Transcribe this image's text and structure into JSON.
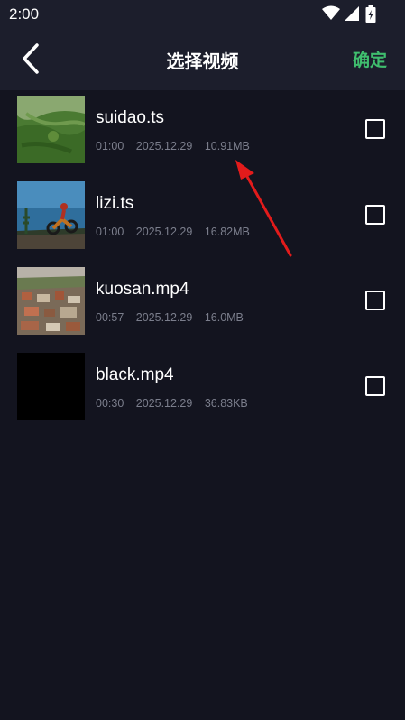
{
  "status_bar": {
    "time": "2:00",
    "icons": [
      "wifi-icon",
      "signal-icon",
      "battery-icon"
    ]
  },
  "app_bar": {
    "title": "选择视频",
    "confirm_label": "确定",
    "back_icon": "chevron-left-icon",
    "accent_color": "#3fbe6e"
  },
  "videos": [
    {
      "name": "suidao.ts",
      "duration": "01:00",
      "date": "2025.12.29",
      "size": "10.91MB",
      "checked": false,
      "thumbnail": "green-hills-aerial"
    },
    {
      "name": "lizi.ts",
      "duration": "01:00",
      "date": "2025.12.29",
      "size": "16.82MB",
      "checked": false,
      "thumbnail": "motocross-rider"
    },
    {
      "name": "kuosan.mp4",
      "duration": "00:57",
      "date": "2025.12.29",
      "size": "16.0MB",
      "checked": false,
      "thumbnail": "town-aerial"
    },
    {
      "name": "black.mp4",
      "duration": "00:30",
      "date": "2025.12.29",
      "size": "36.83KB",
      "checked": false,
      "thumbnail": "black-frame"
    }
  ],
  "annotation": {
    "type": "arrow",
    "color": "#e31b1b"
  }
}
